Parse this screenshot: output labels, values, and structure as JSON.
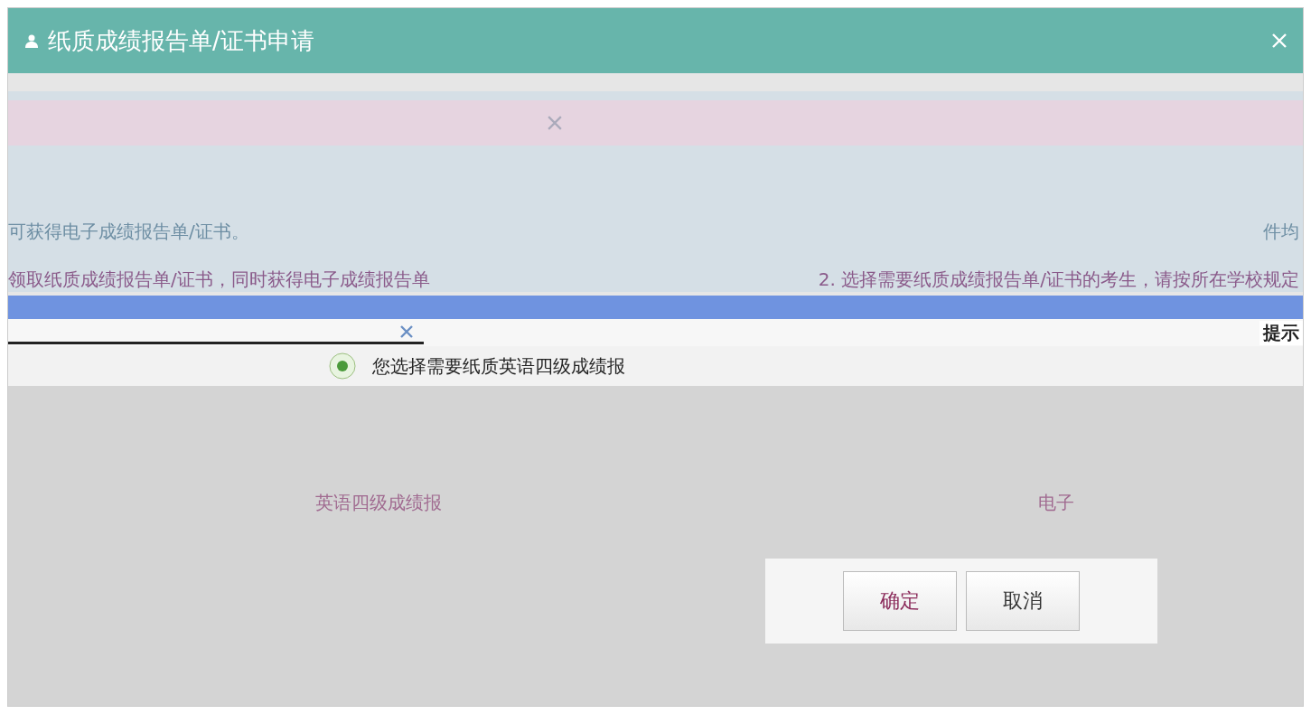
{
  "window": {
    "title": "纸质成绩报告单/证书申请"
  },
  "notice": {
    "lines": [
      {
        "text": "可获得电子成绩报告单/证书。",
        "tail": "件均"
      },
      {
        "text": "领取纸质成绩报告单/证书，同时获得电子成绩报告单",
        "tail": "2. 选择需要纸质成绩报告单/证书的考生，请按所在学校规定"
      }
    ]
  },
  "prompt": {
    "title": "提示",
    "message": "您选择需要纸质英语四级成绩报"
  },
  "table": {
    "rows": [
      {
        "column_1": "英语四级成绩报",
        "column_2": "电子"
      }
    ]
  },
  "buttons": [
    {
      "label": "确定",
      "kind": "primary"
    },
    {
      "label": "取消",
      "kind": "secondary"
    }
  ]
}
